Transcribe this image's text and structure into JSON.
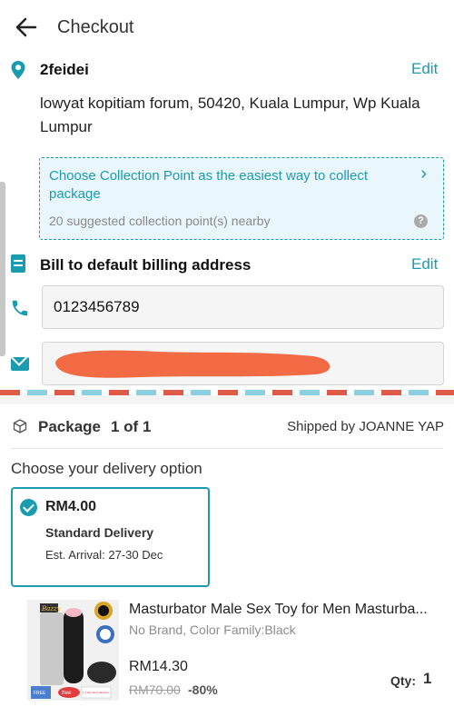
{
  "header": {
    "title": "Checkout"
  },
  "shipping": {
    "recipient": "2feidei",
    "edit_label": "Edit",
    "address": "lowyat kopitiam forum, 50420, Kuala Lumpur, Wp Kuala Lumpur"
  },
  "collection": {
    "title": "Choose Collection Point as the easiest way to collect package",
    "subtitle": "20 suggested collection point(s) nearby",
    "help": "?"
  },
  "billing": {
    "label": "Bill to default billing address",
    "edit_label": "Edit"
  },
  "contact": {
    "phone": "0123456789",
    "email_redacted": true,
    "redaction_color": "#f26b45"
  },
  "package": {
    "label": "Package",
    "count": "1 of 1",
    "shipped_by": "Shipped by JOANNE YAP",
    "choose_label": "Choose your delivery option",
    "delivery": {
      "price": "RM4.00",
      "name": "Standard Delivery",
      "eta": "Est. Arrival:  27-30 Dec",
      "selected": true
    }
  },
  "product": {
    "title": "Masturbator Male Sex Toy for Men Masturba...",
    "variant": "No Brand, Color Family:Black",
    "price": "RM14.30",
    "original_price": "RM70.00",
    "discount": "-80%",
    "qty_label": "Qty:",
    "qty": "1",
    "image_text": {
      "brand": "Bazzy",
      "free1": "FREE",
      "free2": "free",
      "gift": "1 x Sex Gel Lubricant"
    }
  },
  "colors": {
    "accent": "#1a9cb0",
    "collect_bg": "#e9f6fb",
    "airmail_red": "#e05a4a",
    "airmail_blue": "#8ccfe0"
  },
  "icons": [
    "back-arrow-icon",
    "location-pin-icon",
    "chevron-right-icon",
    "help-icon",
    "billing-doc-icon",
    "phone-icon",
    "mail-icon",
    "package-icon",
    "check-circle-icon"
  ]
}
